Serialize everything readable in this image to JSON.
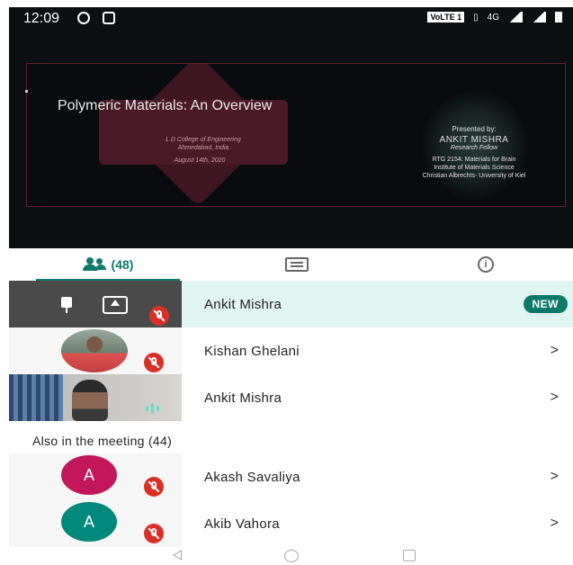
{
  "status_bar": {
    "time": "12:09",
    "carrier_badge": "VoLTE 1",
    "network": "4G"
  },
  "slide": {
    "title": "Polymeric Materials: An Overview",
    "college": "L D College of Engineering",
    "city": "Ahmedabad, India",
    "date": "August 14th, 2020",
    "presented_by": "Presented by:",
    "presenter": "ANKIT MISHRA",
    "role": "Research Fellow",
    "line1": "RTG 2154: Materials for Brain",
    "line2": "Institute of Materials Science",
    "line3": "Christian Albrechts- University of Kiel"
  },
  "tabs": {
    "people_count": "(48)"
  },
  "participants": [
    {
      "name": "Ankit Mishra",
      "badge": "NEW"
    },
    {
      "name": "Kishan Ghelani",
      "chevron": ">"
    },
    {
      "name": "Ankit Mishra",
      "chevron": ">"
    }
  ],
  "also_section": {
    "label": "Also in the meeting (44)"
  },
  "others": [
    {
      "name": "Akash Savaliya",
      "initial": "A",
      "avatar_color": "#c2185b",
      "chevron": ">"
    },
    {
      "name": "Akib Vahora",
      "initial": "A",
      "avatar_color": "#00897b",
      "chevron": ">"
    }
  ],
  "colors": {
    "accent": "#0b7a6a",
    "mute": "#d93025",
    "highlight": "#e0f4f1"
  }
}
